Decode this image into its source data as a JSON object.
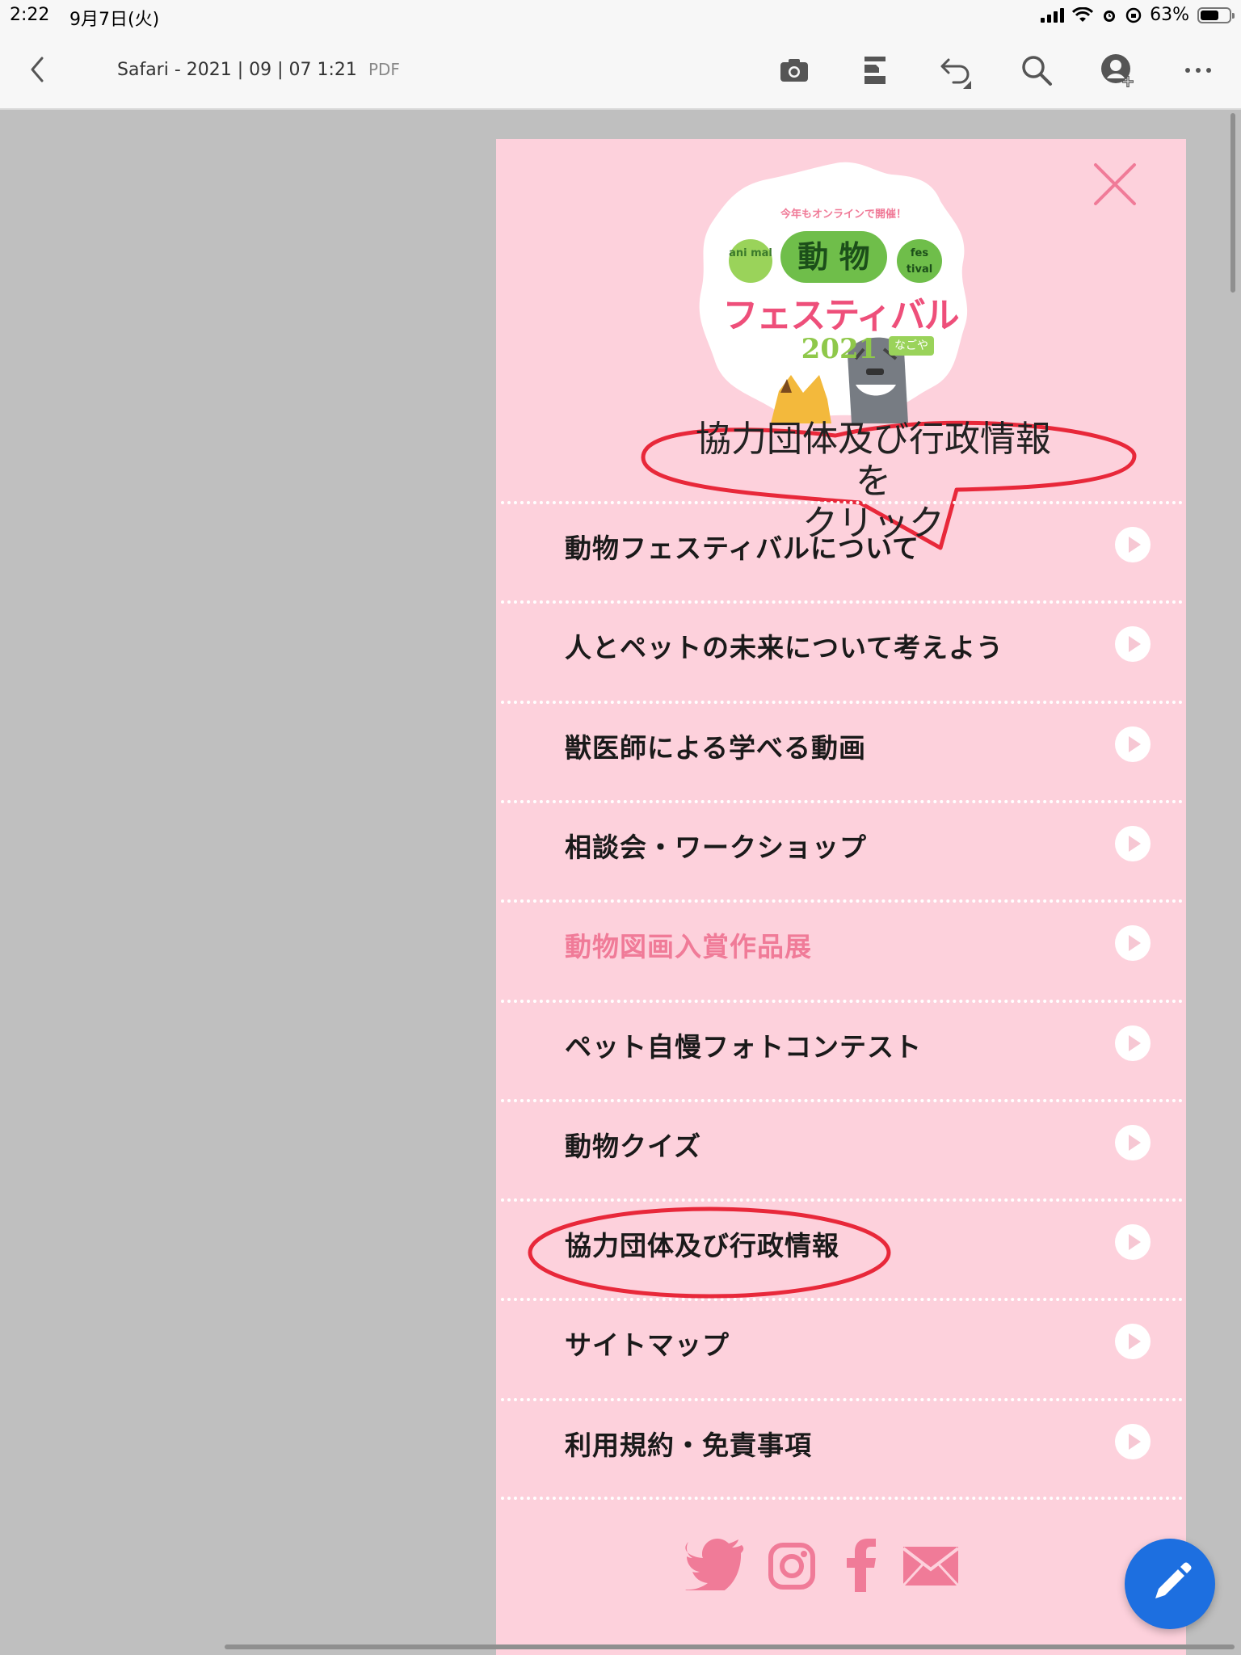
{
  "status_bar": {
    "time": "2:22",
    "date": "9月7日(火)",
    "battery": "63%"
  },
  "toolbar": {
    "title": "Safari - 2021 | 09 | 07 1:21",
    "doc_type": "PDF",
    "icons": [
      "camera-icon",
      "page-layout-icon",
      "undo-icon",
      "search-icon",
      "add-user-icon",
      "more-icon"
    ]
  },
  "logo": {
    "tagline": "今年もオンラインで開催！",
    "line1": "動 物",
    "left_badge": "ani mal",
    "right_badge": "fes tival",
    "line2": "フェスティバル",
    "year": "2021",
    "city": "なごや"
  },
  "annotation": {
    "callout_line1": "協力団体及び行政情報を",
    "callout_line2": "クリック",
    "color": "#e8283a"
  },
  "menu": {
    "items": [
      {
        "label": "動物フェスティバルについて",
        "highlight": false
      },
      {
        "label": "人とペットの未来について考えよう",
        "highlight": false
      },
      {
        "label": "獣医師による学べる動画",
        "highlight": false
      },
      {
        "label": "相談会・ワークショップ",
        "highlight": false
      },
      {
        "label": "動物図画入賞作品展",
        "highlight": true
      },
      {
        "label": "ペット自慢フォトコンテスト",
        "highlight": false
      },
      {
        "label": "動物クイズ",
        "highlight": false
      },
      {
        "label": "協力団体及び行政情報",
        "highlight": false
      },
      {
        "label": "サイトマップ",
        "highlight": false
      },
      {
        "label": "利用規約・免責事項",
        "highlight": false
      }
    ]
  },
  "social": [
    "twitter-icon",
    "instagram-icon",
    "facebook-icon",
    "mail-icon"
  ],
  "colors": {
    "page_bg": "#fdd1dc",
    "accent_pink": "#f07b98",
    "fab_blue": "#1d6fe0"
  }
}
